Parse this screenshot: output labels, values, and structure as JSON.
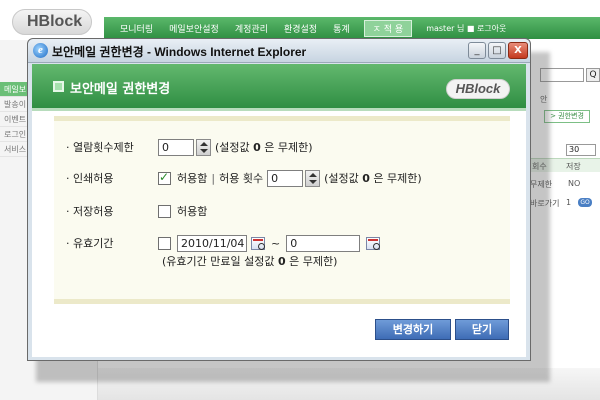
{
  "background": {
    "logo": "HBlock",
    "nav": [
      "모니터링",
      "메일보안설정",
      "계정관리",
      "환경설정",
      "통계",
      "ㅈ 적 용"
    ],
    "user": "master 님 ■ 로그아웃",
    "sidebar": [
      "메일보",
      "발송이",
      "이벤트",
      "로그인",
      "서비스"
    ],
    "right": {
      "search_button": "Q",
      "tab_label": "안",
      "password_button": "> 권한변경",
      "page_size": "30",
      "col1": "회수",
      "col2": "저장",
      "cell1": "무제한",
      "cell2": "NO",
      "goto": "바로가기",
      "page": "1",
      "go": "GO"
    }
  },
  "window": {
    "title": "보안메일 권한변경 - Windows Internet Explorer",
    "minimize": "_",
    "maximize": "□",
    "close": "X"
  },
  "banner": {
    "title": "보안메일 권한변경",
    "logo": "HBlock"
  },
  "form": {
    "view_limit": {
      "label": "· 열람횟수제한",
      "value": "0",
      "note_prefix": "(설정값 ",
      "note_zero": "0",
      "note_suffix": " 은 무제한)"
    },
    "print": {
      "label": "· 인쇄허용",
      "checked": true,
      "allow_label": "허용함",
      "separator": "|",
      "count_label": "허용 횟수",
      "count_value": "0",
      "note_prefix": "(설정값 ",
      "note_zero": "0",
      "note_suffix": " 은 무제한)"
    },
    "save": {
      "label": "· 저장허용",
      "checked": false,
      "allow_label": "허용함"
    },
    "expiry": {
      "label": "· 유효기간",
      "checked": false,
      "start_date": "2010/11/04",
      "tilde": "~",
      "end_value": "0",
      "note_prefix": "(유효기간 만료일 설정값 ",
      "note_zero": "0",
      "note_suffix": " 은 무제한)"
    }
  },
  "buttons": {
    "apply": "변경하기",
    "close": "닫기"
  },
  "colors": {
    "accent_green": "#2f8e43",
    "button_blue": "#3e6cb5",
    "panel_bg": "#fbfbf0"
  }
}
